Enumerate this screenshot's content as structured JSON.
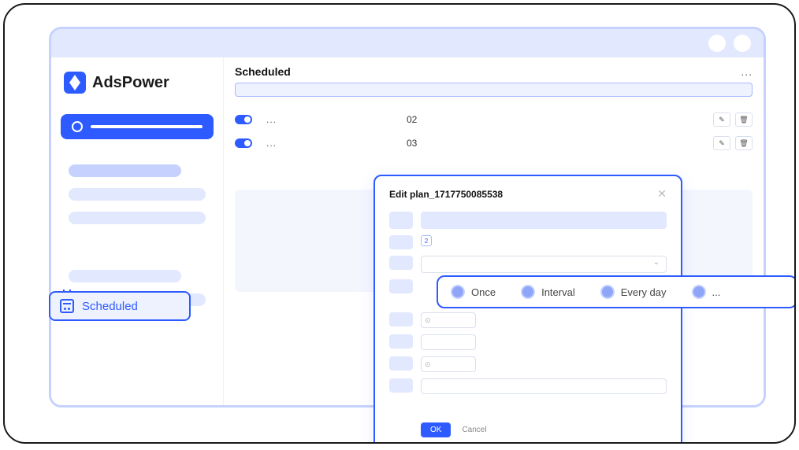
{
  "brand": {
    "name": "AdsPower"
  },
  "sidebar": {
    "scheduled_label": "Scheduled"
  },
  "main": {
    "title": "Scheduled",
    "menu_dots": "...",
    "rows": [
      {
        "dots": "...",
        "num": "02"
      },
      {
        "dots": "...",
        "num": "03"
      }
    ]
  },
  "dialog": {
    "title": "Edit plan_1717750085538",
    "chip_value": "2",
    "time_placeholder": "⊙",
    "ok_label": "OK",
    "cancel_label": "Cancel"
  },
  "frequency": {
    "options": [
      "Once",
      "Interval",
      "Every day",
      "..."
    ]
  }
}
